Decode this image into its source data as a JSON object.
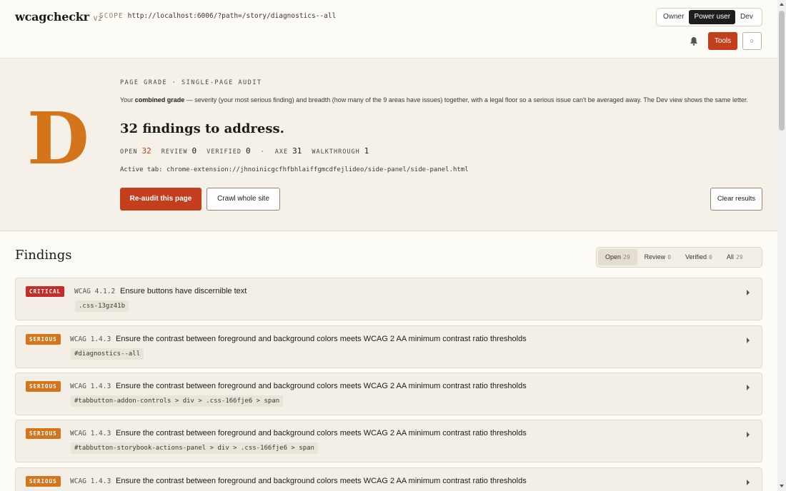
{
  "header": {
    "logo": "wcagcheckr",
    "version": "V2",
    "scope_label": "SCOPE",
    "scope_url": "http://localhost:6006/?path=/story/diagnostics--all",
    "views": [
      {
        "label": "Owner",
        "active": false
      },
      {
        "label": "Power user",
        "active": true
      },
      {
        "label": "Dev",
        "active": false
      }
    ],
    "bell_icon": "bell-icon",
    "tools_label": "Tools",
    "settings_icon": "○"
  },
  "grade": {
    "letter": "D",
    "letter_color": "#d4741b",
    "eyebrow": "PAGE GRADE · SINGLE-PAGE AUDIT",
    "desc_pre": "Your ",
    "desc_bold": "combined grade",
    "desc_post": " — severity (your most serious finding) and breadth (how many of the 9 areas have issues) together, with a legal floor so a serious issue can't be averaged away. The Dev view shows the same letter.",
    "headline": "32 findings to address.",
    "stats": {
      "open_label": "OPEN",
      "open": "32",
      "review_label": "REVIEW",
      "review": "0",
      "verified_label": "VERIFIED",
      "verified": "0",
      "sep": "·",
      "axe_label": "AXE",
      "axe": "31",
      "walkthrough_label": "WALKTHROUGH",
      "walkthrough": "1"
    },
    "active_tab": "Active tab: chrome-extension://jhnoinicgcfhfbhlaiffgmcdfejlideo/side-panel/side-panel.html",
    "reaudit_label": "Re-audit this page",
    "crawl_label": "Crawl whole site",
    "clear_label": "Clear results"
  },
  "findings": {
    "title": "Findings",
    "filters": [
      {
        "label": "Open",
        "count": "29",
        "active": true
      },
      {
        "label": "Review",
        "count": "0",
        "active": false
      },
      {
        "label": "Verified",
        "count": "0",
        "active": false
      },
      {
        "label": "All",
        "count": "29",
        "active": false
      }
    ],
    "items": [
      {
        "severity": "CRITICAL",
        "wcag": "WCAG 4.1.2",
        "title": "Ensure buttons have discernible text",
        "selector": ".css-13gz41b"
      },
      {
        "severity": "SERIOUS",
        "wcag": "WCAG 1.4.3",
        "title": "Ensure the contrast between foreground and background colors meets WCAG 2 AA minimum contrast ratio thresholds",
        "selector": "#diagnostics--all"
      },
      {
        "severity": "SERIOUS",
        "wcag": "WCAG 1.4.3",
        "title": "Ensure the contrast between foreground and background colors meets WCAG 2 AA minimum contrast ratio thresholds",
        "selector": "#tabbutton-addon-controls > div > .css-166fje6 > span"
      },
      {
        "severity": "SERIOUS",
        "wcag": "WCAG 1.4.3",
        "title": "Ensure the contrast between foreground and background colors meets WCAG 2 AA minimum contrast ratio thresholds",
        "selector": "#tabbutton-storybook-actions-panel > div > .css-166fje6 > span"
      },
      {
        "severity": "SERIOUS",
        "wcag": "WCAG 1.4.3",
        "title": "Ensure the contrast between foreground and background colors meets WCAG 2 AA minimum contrast ratio thresholds",
        "selector": ""
      }
    ]
  },
  "colors": {
    "accent": "#c23e1c",
    "critical": "#c22f2a",
    "serious": "#d4741b"
  }
}
